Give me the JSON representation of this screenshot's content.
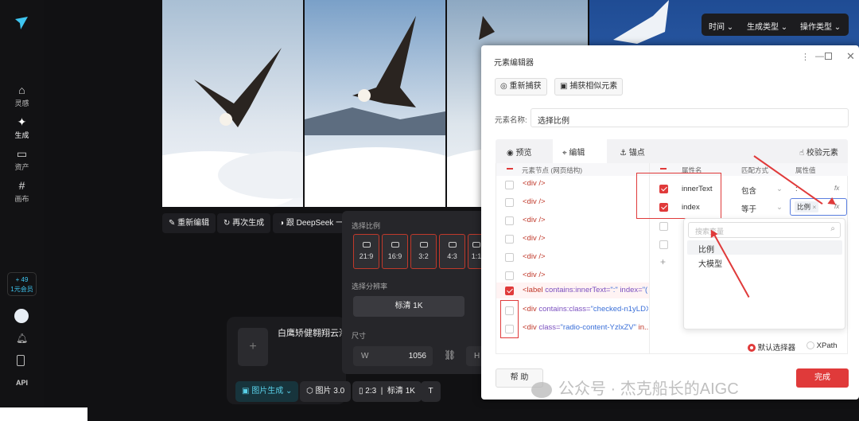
{
  "nav": {
    "items": [
      {
        "label": "灵感",
        "icon": "home-icon"
      },
      {
        "label": "生成",
        "icon": "sparkle-icon"
      },
      {
        "label": "资产",
        "icon": "folder-icon"
      },
      {
        "label": "画布",
        "icon": "canvas-icon"
      }
    ],
    "credits": "+ 49",
    "member": "1元会员",
    "api": "API"
  },
  "filters": {
    "time": "时间",
    "gen_type": "生成类型",
    "op_type": "操作类型"
  },
  "toolbar": {
    "re_edit": "重新编辑",
    "regen": "再次生成",
    "deepseek": "跟 DeepSeek 一起"
  },
  "ratio_panel": {
    "title": "选择比例",
    "ratios": [
      "21:9",
      "16:9",
      "3:2",
      "4:3",
      "1:1"
    ],
    "resolution_title": "选择分辨率",
    "resolution": "标清 1K",
    "size_title": "尺寸",
    "w_label": "W",
    "w_value": "1056",
    "h_label": "H"
  },
  "prompt": {
    "text": "白鹰矫健翱翔云海间"
  },
  "bottom": {
    "mode": "图片生成",
    "model": "图片 3.0",
    "ratio": "2:3",
    "quality": "标清 1K"
  },
  "dialog": {
    "title": "元素编辑器",
    "recapture": "重新捕获",
    "capture_similar": "捕获相似元素",
    "name_label": "元素名称:",
    "name_value": "选择比例",
    "tabs": [
      "预览",
      "编辑",
      "锚点"
    ],
    "verify": "校验元素",
    "tree_header": "元素节点 (网页结构)",
    "nodes": [
      {
        "text": "<div />"
      },
      {
        "text": "<div />"
      },
      {
        "text": "<div />"
      },
      {
        "text": "<div />"
      },
      {
        "text": "<div />"
      },
      {
        "text": "<div />"
      }
    ],
    "node_label": {
      "tag": "<label ",
      "attr": "contains:innerText=",
      "val": "\":\"",
      "attr2": " index=",
      "val2": "\"(..."
    },
    "node_div1": {
      "tag": "<div ",
      "attr": "contains:class=",
      "val": "\"checked-n1yLDX..."
    },
    "node_div2": {
      "tag": "<div ",
      "attr": "class=",
      "val": "\"radio-content-YzlxZV\"",
      "rest": " in..."
    },
    "attr_headers": {
      "name": "属性名",
      "match": "匹配方式",
      "value": "属性值"
    },
    "attrs": [
      {
        "name": "innerText",
        "match": "包含",
        "value": ":",
        "fx": "fx"
      },
      {
        "name": "index",
        "match": "等于",
        "value": "比例",
        "fx": "fx"
      }
    ],
    "search_placeholder": "搜索变量",
    "dropdown": [
      "比例",
      "大模型"
    ],
    "selectors": {
      "default": "默认选择器",
      "xpath": "XPath"
    },
    "help": "帮 助",
    "done": "完成"
  },
  "watermark": "公众号 · 杰克船长的AIGC"
}
